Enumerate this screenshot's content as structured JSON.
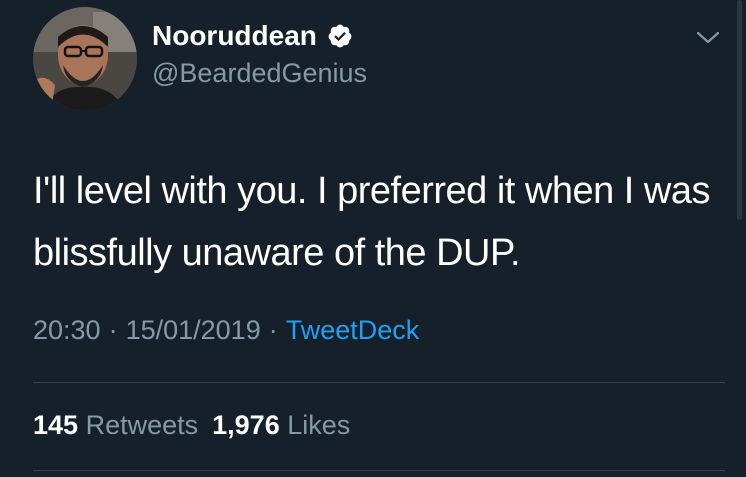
{
  "tweet": {
    "author": {
      "name": "Nooruddean",
      "handle": "@BeardedGenius",
      "verified": true
    },
    "text": "I'll level with you. I preferred it when I was blissfully unaware of the DUP.",
    "time": "20:30",
    "date": "15/01/2019",
    "separator": "·",
    "source": "TweetDeck",
    "stats": {
      "retweets_count": "145",
      "retweets_label": "Retweets",
      "likes_count": "1,976",
      "likes_label": "Likes"
    }
  },
  "colors": {
    "background": "#15202b",
    "primary_text": "#ffffff",
    "secondary_text": "#8899a6",
    "accent": "#1da1f2",
    "divider": "#38444d"
  },
  "icons": {
    "verified": "verified-badge-icon",
    "more": "chevron-down-icon"
  }
}
